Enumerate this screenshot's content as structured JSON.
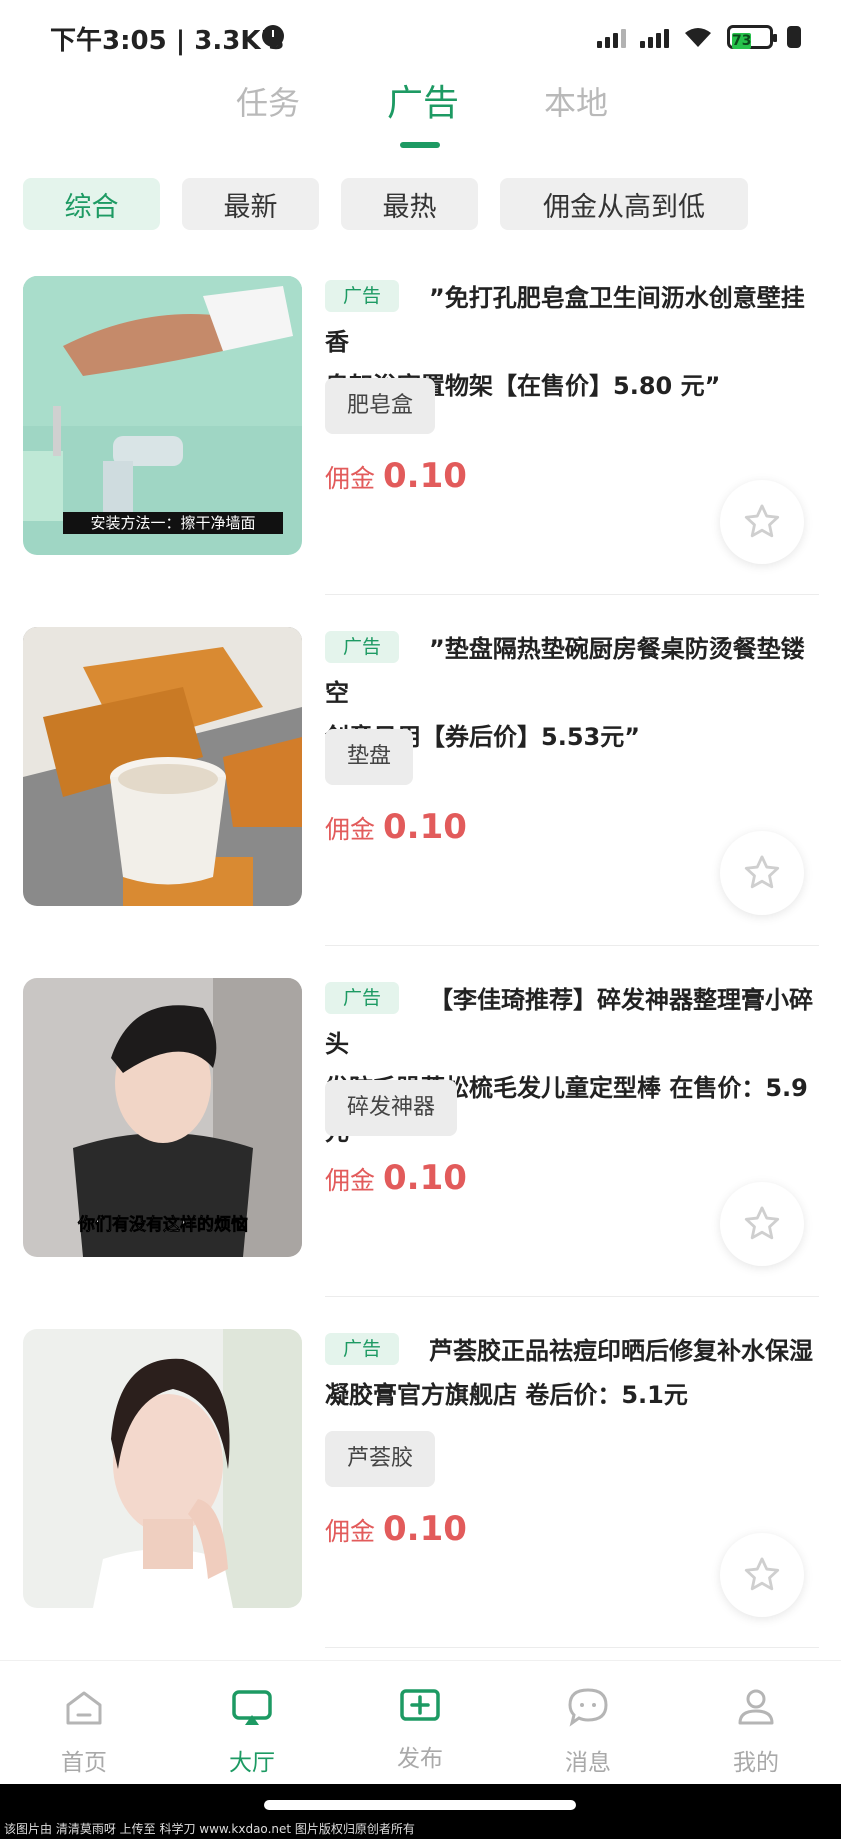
{
  "status_bar": {
    "time_text": "下午3:05 | 3.3K's",
    "battery": "73"
  },
  "top_tabs": [
    {
      "label": "任务",
      "active": false
    },
    {
      "label": "广告",
      "active": true
    },
    {
      "label": "本地",
      "active": false
    }
  ],
  "filters": [
    {
      "label": "综合",
      "active": true
    },
    {
      "label": "最新",
      "active": false
    },
    {
      "label": "最热",
      "active": false
    },
    {
      "label": "佣金从高到低",
      "active": false
    }
  ],
  "items": [
    {
      "badge": "广告",
      "title_line1": "”免打孔肥皂盒卫生间沥水创意壁挂香",
      "title_line2": "皂架浴室置物架【在售价】5.80 元”",
      "tag": "肥皂盒",
      "commission_label": "佣金",
      "commission_value": "0.10",
      "thumb_caption": "安装方法一：擦干净墙面",
      "thumb_icon": "bathroom-faucet-image"
    },
    {
      "badge": "广告",
      "title_line1": "”垫盘隔热垫碗厨房餐桌防烫餐垫镂空",
      "title_line2": "创意日用【券后价】5.53元”",
      "tag": "垫盘",
      "commission_label": "佣金",
      "commission_value": "0.10",
      "thumb_caption": "",
      "thumb_icon": "wooden-coasters-image"
    },
    {
      "badge": "广告",
      "title_line1": "【李佳琦推荐】碎发神器整理膏小碎头",
      "title_line2": "发防毛躁蓬松梳毛发儿童定型棒 在售价：5.9元",
      "tag": "碎发神器",
      "commission_label": "佣金",
      "commission_value": "0.10",
      "thumb_caption": "你们有没有这样的烦恼",
      "thumb_icon": "woman-hair-image"
    },
    {
      "badge": "广告",
      "title_line1": "芦荟胶正品祛痘印晒后修复补水保湿",
      "title_line2": "凝胶膏官方旗舰店 卷后价：5.1元",
      "tag": "芦荟胶",
      "commission_label": "佣金",
      "commission_value": "0.10",
      "thumb_caption": "",
      "thumb_icon": "woman-skincare-image"
    }
  ],
  "bottom_nav": [
    {
      "label": "首页",
      "icon": "home-icon",
      "active": false
    },
    {
      "label": "大厅",
      "icon": "hall-screen-icon",
      "active": true
    },
    {
      "label": "发布",
      "icon": "publish-plus-icon",
      "active": false
    },
    {
      "label": "消息",
      "icon": "message-bubble-icon",
      "active": false
    },
    {
      "label": "我的",
      "icon": "profile-icon",
      "active": false
    }
  ],
  "footer_note": "该图片由 清清莫雨呀 上传至 科学刀 www.kxdao.net 图片版权归原创者所有",
  "colors": {
    "accent": "#1d9a63",
    "accent_bg": "#e4f4ec",
    "commission": "#e25b5b",
    "chip_bg": "#efefef"
  }
}
